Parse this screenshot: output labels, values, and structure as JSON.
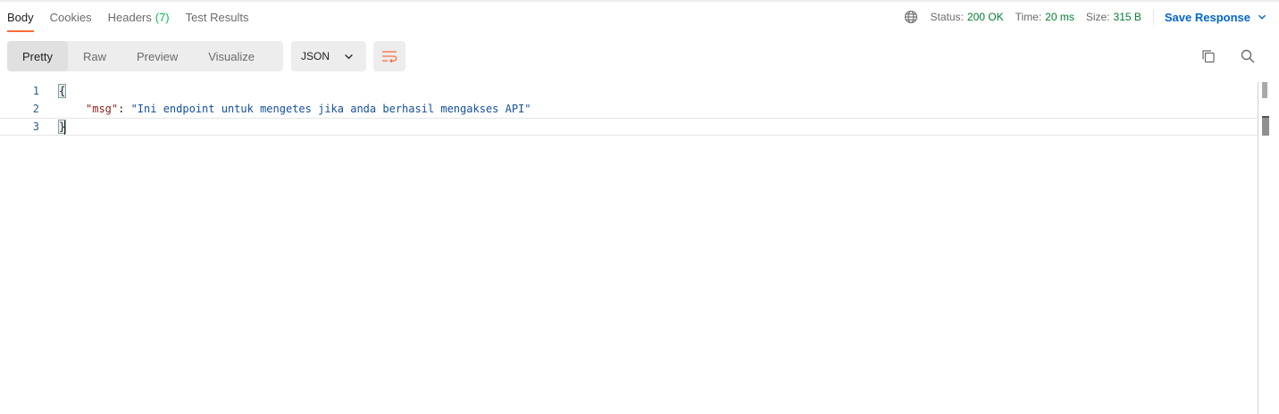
{
  "tabs": [
    {
      "label": "Body",
      "active": true
    },
    {
      "label": "Cookies"
    },
    {
      "label": "Headers",
      "count": "(7)"
    },
    {
      "label": "Test Results"
    }
  ],
  "status": {
    "globe_icon": "globe-icon",
    "status_label": "Status:",
    "status_value": "200 OK",
    "time_label": "Time:",
    "time_value": "20 ms",
    "size_label": "Size:",
    "size_value": "315 B",
    "save_label": "Save Response"
  },
  "toolbar": {
    "views": [
      "Pretty",
      "Raw",
      "Preview",
      "Visualize"
    ],
    "active_view": "Pretty",
    "format": "JSON",
    "wrap_icon": "wrap-lines-icon",
    "copy_icon": "copy-icon",
    "search_icon": "search-icon"
  },
  "editor": {
    "line_numbers": [
      "1",
      "2",
      "3"
    ],
    "open_brace": "{",
    "key": "\"msg\"",
    "colon": ": ",
    "value": "\"Ini endpoint untuk mengetes jika anda berhasil mengakses API\"",
    "close_brace": "}"
  },
  "colors": {
    "accent": "#ff6c37",
    "status_ok": "#007f31",
    "link": "#0265d2",
    "json_key": "#8c1a1a",
    "json_string": "#1450a0"
  }
}
